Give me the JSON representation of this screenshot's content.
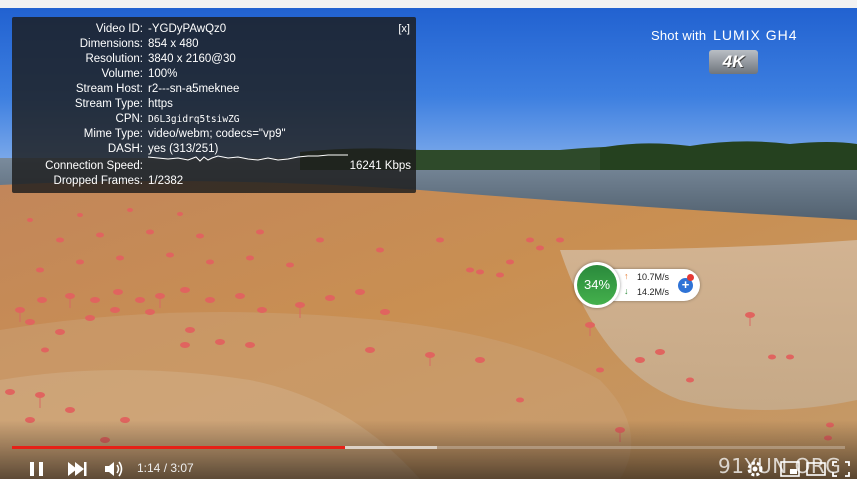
{
  "stats": {
    "rows": [
      {
        "label": "Video ID:",
        "value": "-YGDyPAwQz0"
      },
      {
        "label": "Dimensions:",
        "value": "854 x 480"
      },
      {
        "label": "Resolution:",
        "value": "3840 x 2160@30"
      },
      {
        "label": "Volume:",
        "value": "100%"
      },
      {
        "label": "Stream Host:",
        "value": "r2---sn-a5meknee"
      },
      {
        "label": "Stream Type:",
        "value": "https"
      },
      {
        "label": "CPN:",
        "value": "D6L3gidrq5tsiwZG"
      },
      {
        "label": "Mime Type:",
        "value": "video/webm; codecs=\"vp9\""
      },
      {
        "label": "DASH:",
        "value": "yes (313/251)"
      }
    ],
    "connection_label": "Connection Speed:",
    "connection_value": "16241 Kbps",
    "dropped_label": "Dropped Frames:",
    "dropped_value": "1/2382",
    "close_label": "[x]"
  },
  "brand": {
    "shot_with": "Shot with",
    "camera": "LUMIX GH4",
    "badge": "4K"
  },
  "network": {
    "percent": "34%",
    "upload": "10.7M/s",
    "download": "14.2M/s",
    "plus": "+"
  },
  "controls": {
    "current_time": "1:14",
    "separator": " / ",
    "duration": "3:07",
    "played_fraction": 0.4,
    "buffered_fraction": 0.51
  },
  "watermark": "91YUN.ORG",
  "icons": [
    "pause-icon",
    "next-icon",
    "volume-icon",
    "settings-icon",
    "miniplayer-icon",
    "theater-icon",
    "fullscreen-icon"
  ]
}
